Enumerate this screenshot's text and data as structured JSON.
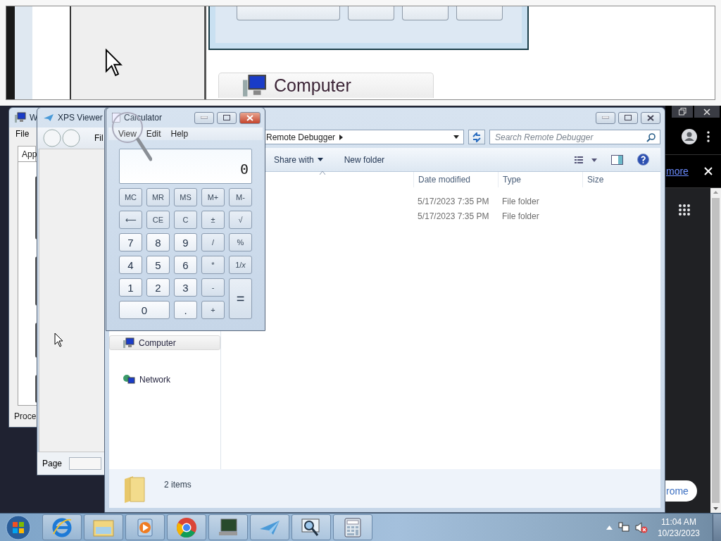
{
  "magnifier": {
    "nav_item": "Computer"
  },
  "chrome": {
    "infobar_link": "more",
    "pill_button": "rome"
  },
  "task_manager": {
    "title": "W",
    "menu": "File",
    "tab": "App",
    "status": "Proce"
  },
  "xps_viewer": {
    "title": "XPS Viewer",
    "menu": "Fil",
    "page_label": "Page"
  },
  "explorer": {
    "address": "Remote Debugger",
    "search": {
      "placeholder": "Search Remote Debugger"
    },
    "toolbar": [
      {
        "label": "Share with",
        "dropdown": true
      },
      {
        "label": "New folder",
        "dropdown": false
      }
    ],
    "columns": [
      "Date modified",
      "Type",
      "Size"
    ],
    "rows": [
      {
        "date_modified": "5/17/2023 7:35 PM",
        "type": "File folder"
      },
      {
        "date_modified": "5/17/2023 7:35 PM",
        "type": "File folder"
      }
    ],
    "nav": [
      {
        "label": "Computer",
        "selected": true
      },
      {
        "label": "Network",
        "selected": false
      }
    ],
    "status": "2 items"
  },
  "calculator": {
    "title": "Calculator",
    "menu": [
      "View",
      "Edit",
      "Help"
    ],
    "display": "0",
    "keys": [
      {
        "label": "MC",
        "kind": "function"
      },
      {
        "label": "MR",
        "kind": "function"
      },
      {
        "label": "MS",
        "kind": "function"
      },
      {
        "label": "M+",
        "kind": "function"
      },
      {
        "label": "M-",
        "kind": "function"
      },
      {
        "label": "⟵",
        "kind": "function"
      },
      {
        "label": "CE",
        "kind": "function"
      },
      {
        "label": "C",
        "kind": "function"
      },
      {
        "label": "±",
        "kind": "function"
      },
      {
        "label": "√",
        "kind": "function"
      },
      {
        "label": "7",
        "kind": "digit"
      },
      {
        "label": "8",
        "kind": "digit"
      },
      {
        "label": "9",
        "kind": "digit"
      },
      {
        "label": "/",
        "kind": "function"
      },
      {
        "label": "%",
        "kind": "function"
      },
      {
        "label": "4",
        "kind": "digit"
      },
      {
        "label": "5",
        "kind": "digit"
      },
      {
        "label": "6",
        "kind": "digit"
      },
      {
        "label": "*",
        "kind": "function"
      },
      {
        "label": "1/*x*",
        "kind": "function"
      },
      {
        "label": "1",
        "kind": "digit"
      },
      {
        "label": "2",
        "kind": "digit"
      },
      {
        "label": "3",
        "kind": "digit"
      },
      {
        "label": "-",
        "kind": "function"
      },
      {
        "label": "=",
        "kind": "equals"
      },
      {
        "label": "0",
        "kind": "zero"
      },
      {
        "label": ".",
        "kind": "digit"
      },
      {
        "label": "+",
        "kind": "function"
      }
    ]
  },
  "taskbar": {
    "time": "11:04 AM",
    "date": "10/23/2023"
  }
}
